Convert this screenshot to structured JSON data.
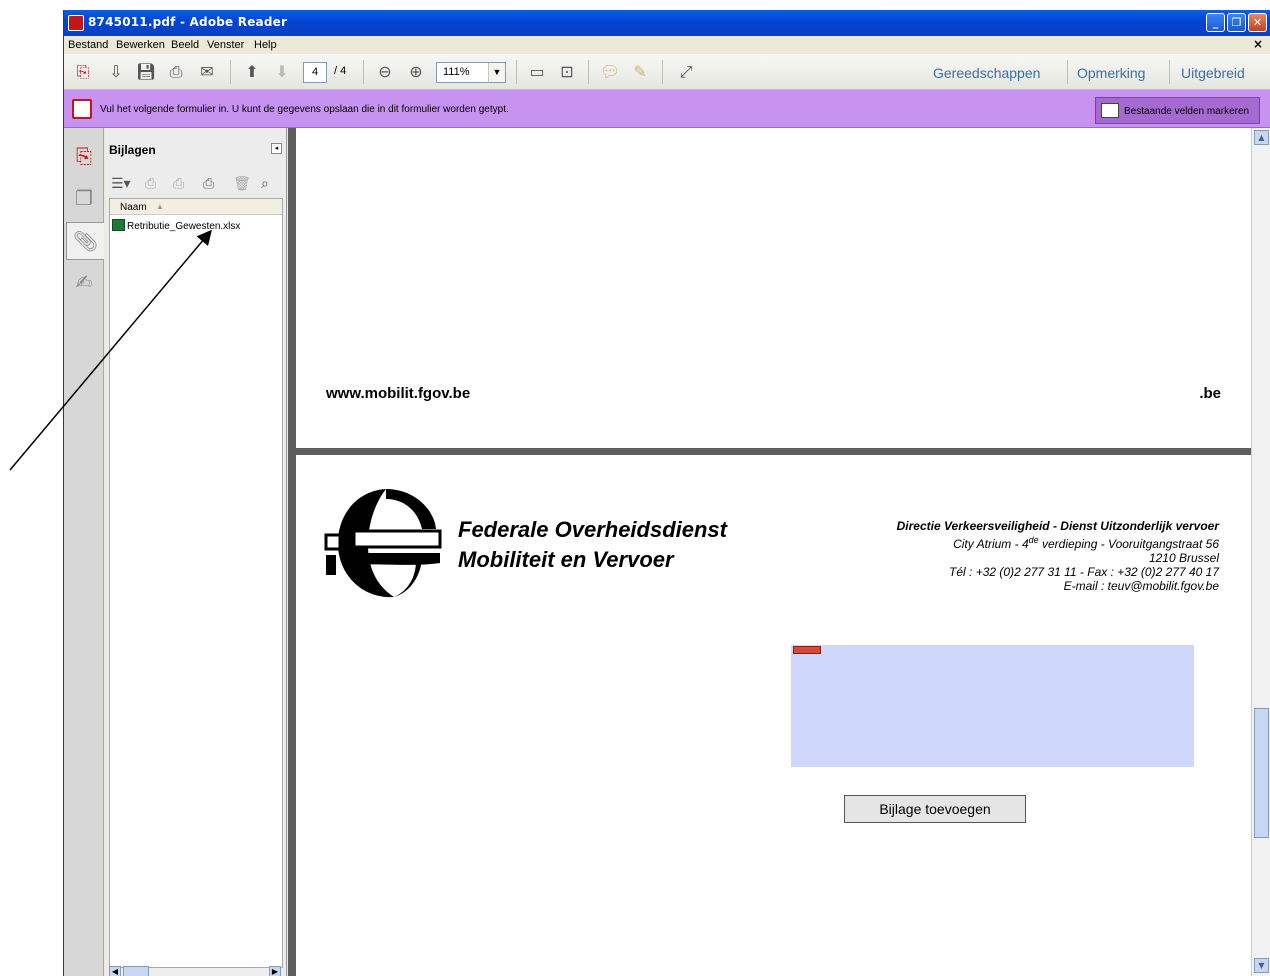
{
  "window": {
    "title": "8745011.pdf - Adobe Reader"
  },
  "menu": {
    "items": [
      "Bestand",
      "Bewerken",
      "Beeld",
      "Venster",
      "Help"
    ],
    "close_glyph": "×"
  },
  "toolbar": {
    "page_current": "4",
    "page_total": "/ 4",
    "zoom": "111%",
    "links": [
      "Gereedschappen",
      "Opmerking",
      "Uitgebreid"
    ]
  },
  "formbar": {
    "message": "Vul het volgende formulier in. U kunt de gegevens opslaan die in dit formulier worden getypt.",
    "highlight_button": "Bestaande velden markeren",
    "color": "#c892f0"
  },
  "attachments_panel": {
    "title": "Bijlagen",
    "column_header": "Naam",
    "files": [
      "Retributie_Gewesten.xlsx"
    ]
  },
  "page1": {
    "url": "www.mobilit.fgov.be",
    "suffix": ".be"
  },
  "page2": {
    "org_line1": "Federale Overheidsdienst",
    "org_line2": "Mobiliteit en Vervoer",
    "addr_line1": "Directie Verkeersveiligheid - Dienst Uitzonderlijk vervoer",
    "addr_line2a": "City Atrium  - 4",
    "addr_sup": "de",
    "addr_line2b": " verdieping - Vooruitgangstraat 56",
    "addr_line3": "1210 Brussel",
    "addr_line4": "Tél : +32 (0)2 277 31 11 - Fax : +32 (0)2 277 40 17",
    "addr_line5": "E-mail : teuv@mobilit.fgov.be",
    "add_attachment_button": "Bijlage toevoegen"
  },
  "icons": [
    "pdf-icon",
    "save-icon",
    "print-icon",
    "email-icon",
    "prev-page-icon",
    "next-page-icon",
    "zoom-out-icon",
    "zoom-in-icon",
    "fit-page-icon",
    "comment-icon",
    "expand-icon",
    "attachment-icon",
    "excel-file-icon"
  ]
}
